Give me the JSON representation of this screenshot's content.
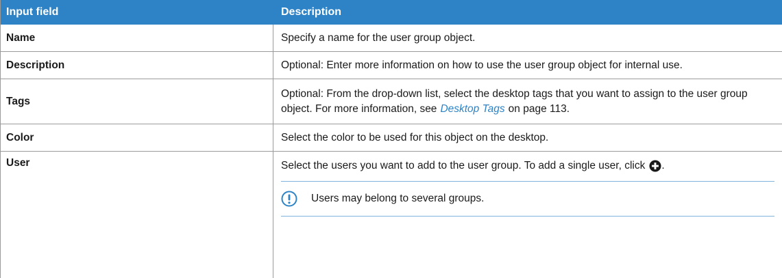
{
  "header": {
    "col1": "Input field",
    "col2": "Description"
  },
  "rows": [
    {
      "field": "Name",
      "description": "Specify a name for the user group object."
    },
    {
      "field": "Description",
      "description": "Optional: Enter more information on how to use the user group object for internal use."
    },
    {
      "field": "Tags",
      "description_before_link": "Optional: From the drop-down list, select the desktop tags that you want to assign to the user group object. For more information, see",
      "link_text": "Desktop Tags",
      "description_after_link": "on page 113."
    },
    {
      "field": "Color",
      "description": "Select the color to be used for this object on the desktop."
    },
    {
      "field": "User",
      "description": "Select the users you want to add to the user group. To add a single user, click",
      "description_end": ".",
      "note": "Users may belong to several groups."
    }
  ],
  "icons": {
    "add": "plus-circle-icon",
    "note": "exclamation-circle-icon"
  },
  "colors": {
    "header_bg": "#2d83c6",
    "link": "#2d83c6",
    "note_line": "#7fb2dc"
  }
}
